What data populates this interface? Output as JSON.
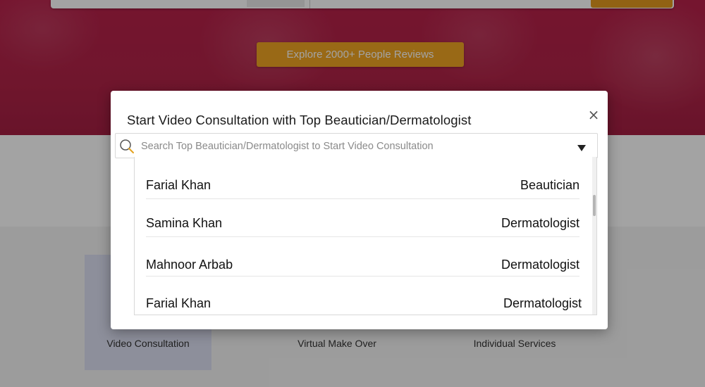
{
  "background": {
    "explore_button": "Explore 2000+ People Reviews",
    "services": [
      {
        "label": "Video Consultation"
      },
      {
        "label": "Virtual Make Over"
      },
      {
        "label": "Individual Services"
      }
    ]
  },
  "modal": {
    "title": "Start Video Consultation with Top Beautician/Dermatologist",
    "close_label": "×",
    "search": {
      "placeholder": "Search Top Beautician/Dermatologist to Start Video Consultation",
      "value": ""
    },
    "results": [
      {
        "name": "Farial Khan",
        "specialty": "Beautician"
      },
      {
        "name": "Samina Khan",
        "specialty": "Dermatologist"
      },
      {
        "name": "Mahnoor Arbab",
        "specialty": "Dermatologist"
      },
      {
        "name": "Farial Khan",
        "specialty": "Dermatologist"
      }
    ]
  },
  "colors": {
    "hero": "#b02347",
    "accent_button": "#f0a523",
    "active_service": "#dde0f2"
  },
  "icons": {
    "search": "search-icon",
    "close": "close-icon",
    "dropdown": "chevron-down-icon"
  }
}
